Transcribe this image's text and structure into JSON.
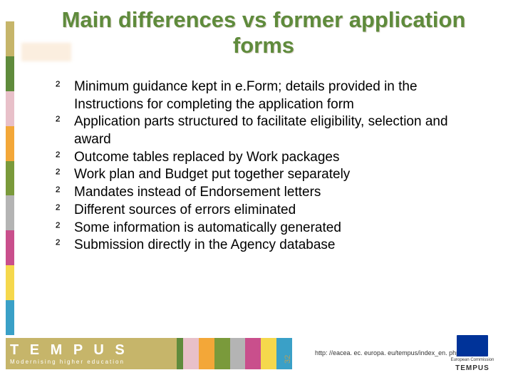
{
  "title": "Main differences vs former application forms",
  "bullets": [
    "Minimum guidance kept in e.Form; details provided in the Instructions for completing the application form",
    "Application parts structured to facilitate eligibility, selection and award",
    "Outcome tables replaced by Work packages",
    "Work plan and Budget put together separately",
    "Mandates instead of Endorsement letters",
    "Different sources of errors eliminated",
    "Some information is automatically generated",
    "Submission directly in the Agency database"
  ],
  "footer": {
    "logo_word": "T E M P U S",
    "logo_sub": "Modernising higher education",
    "url": "http: //eacea. ec. europa. eu/tempus/index_en. php",
    "slide_num": "32",
    "ec_line1": "European Commission",
    "ec_brand": "TEMPUS"
  },
  "bullet_marker": "²"
}
